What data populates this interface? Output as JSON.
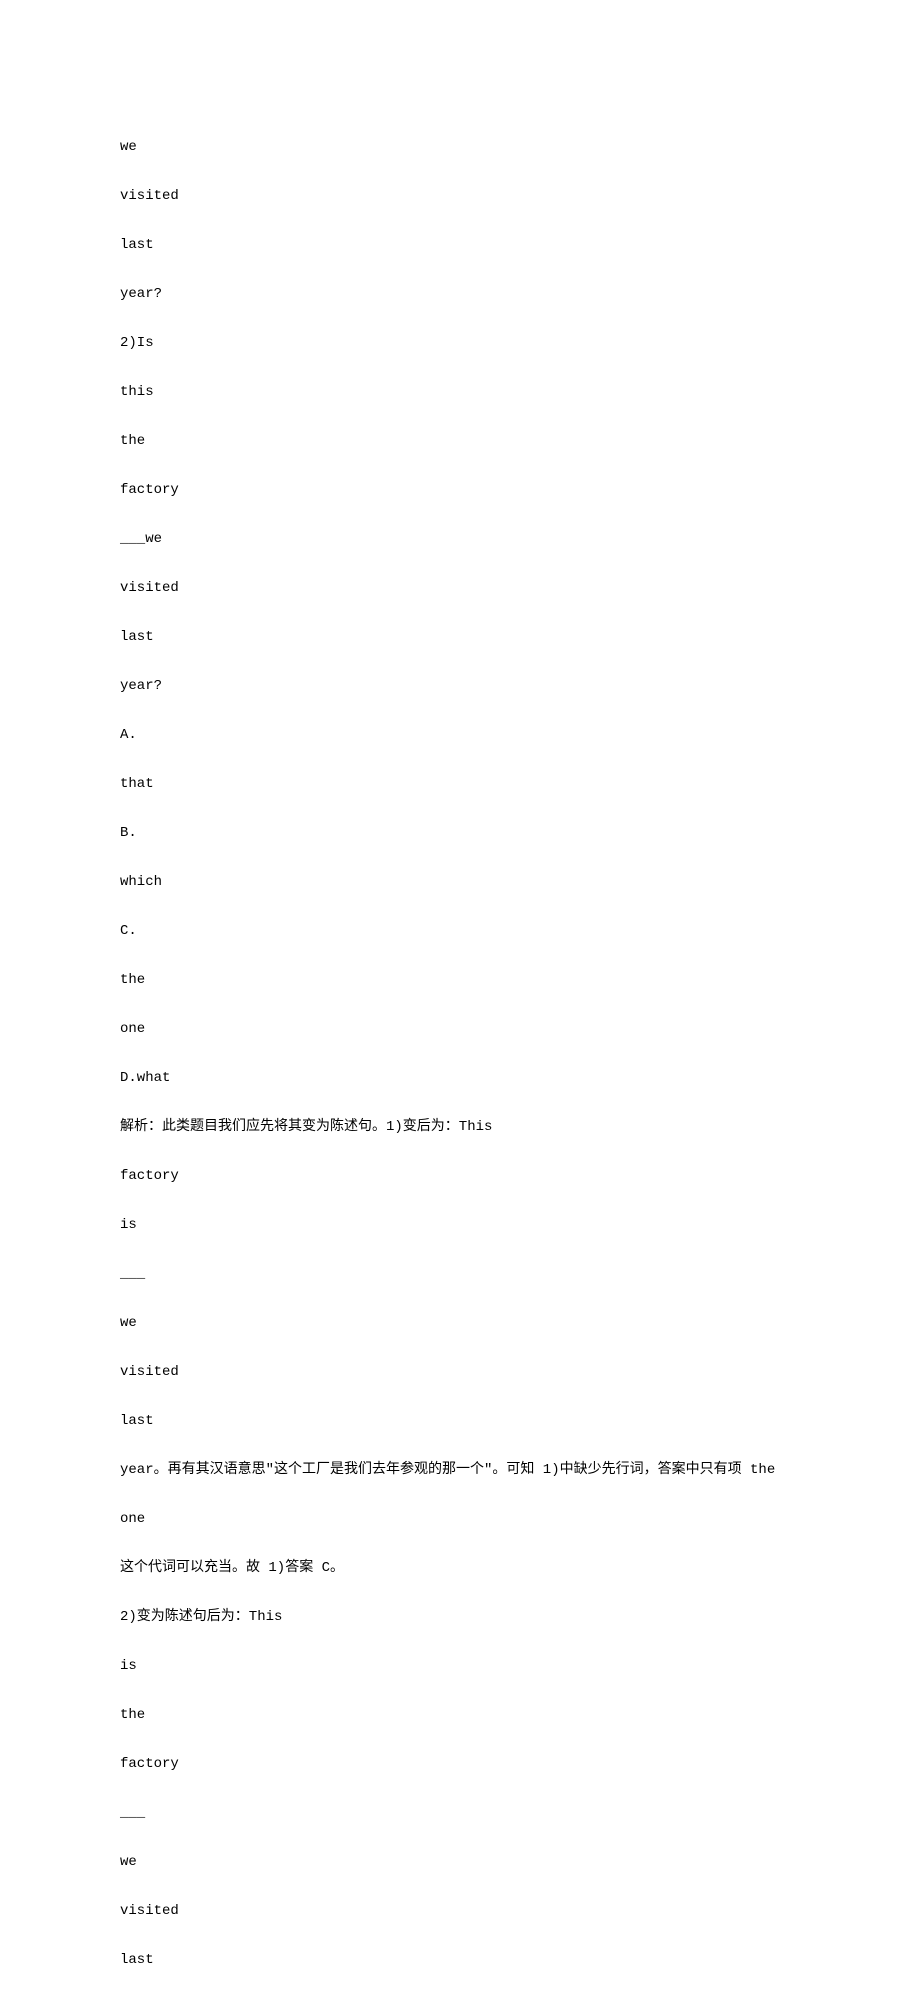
{
  "lines": [
    "we",
    "visited",
    "last",
    "year?",
    "2)Is",
    "this",
    "the",
    "factory",
    "___we",
    "visited",
    "last",
    "year?",
    "A.",
    "that",
    "B.",
    "which",
    "C.",
    "the",
    "one",
    "D.what",
    "解析：此类题目我们应先将其变为陈述句。1)变后为：This",
    "factory",
    "is",
    "___",
    "we",
    "visited",
    "last",
    "year。再有其汉语意思\"这个工厂是我们去年参观的那一个\"。可知 1)中缺少先行词，答案中只有项 the",
    "one",
    "这个代词可以充当。故 1)答案 C。",
    "2)变为陈述句后为：This",
    "is",
    "the",
    "factory",
    "___",
    "we",
    "visited",
    "last"
  ]
}
